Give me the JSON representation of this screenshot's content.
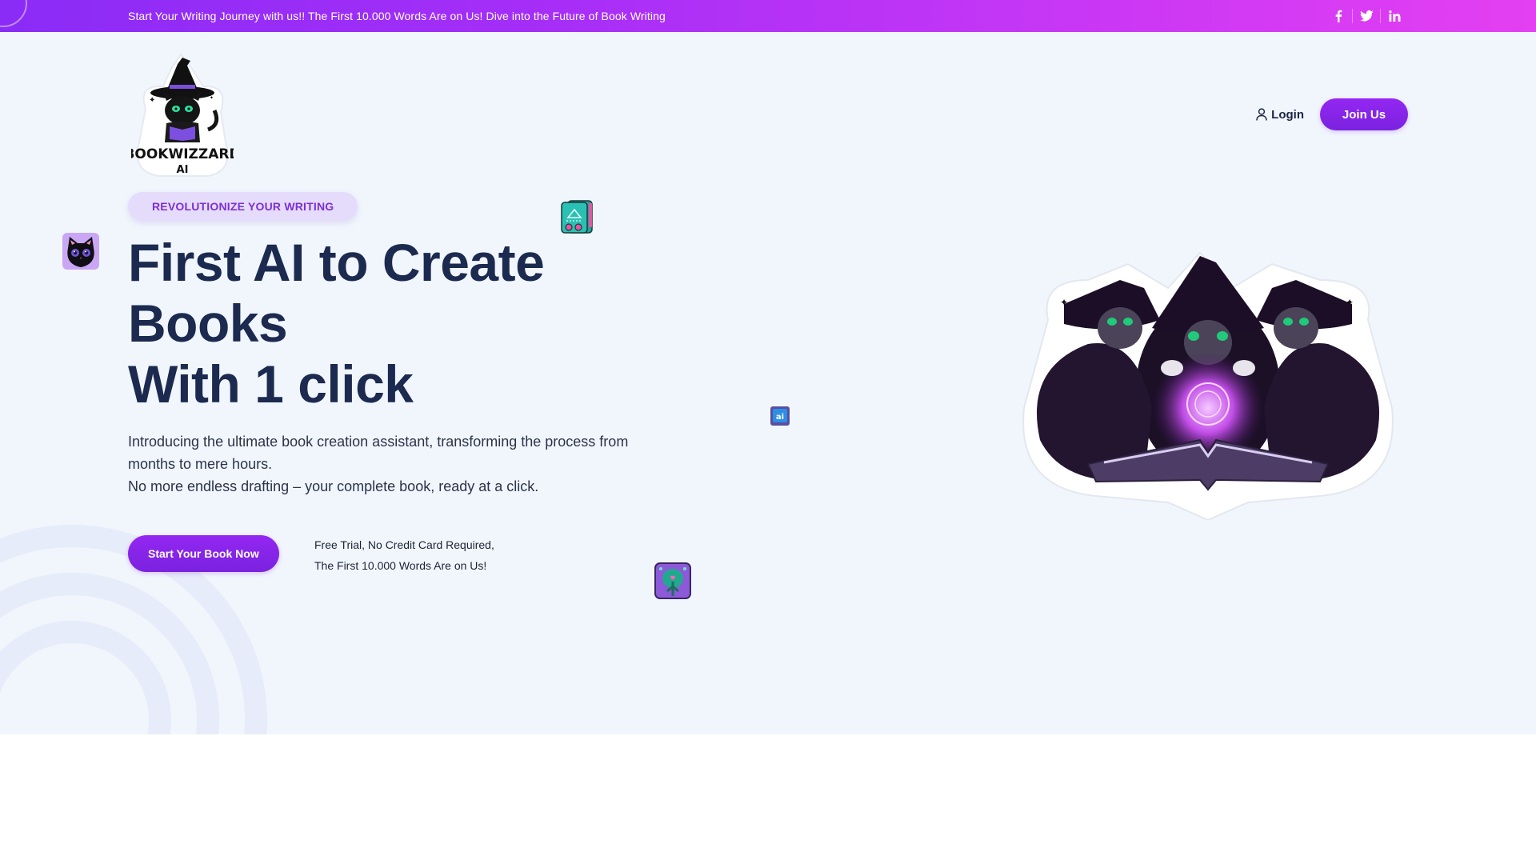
{
  "topbar": {
    "announcement": "Start Your Writing Journey with us!! The First 10.000 Words Are on Us! Dive into the Future of Book Writing",
    "socials": [
      {
        "name": "facebook",
        "icon": "facebook-icon",
        "glyph": "f"
      },
      {
        "name": "twitter",
        "icon": "twitter-icon",
        "glyph": "🐦"
      },
      {
        "name": "linkedin",
        "icon": "linkedin-icon",
        "glyph": "in"
      }
    ],
    "gradient": [
      "#8a2cf6",
      "#e43ff2"
    ]
  },
  "header": {
    "logo": {
      "name": "BookWizzard AI",
      "line1": "BOOKWIZZARD",
      "line2": "AI"
    },
    "login_label": "Login",
    "login_icon": "user-icon",
    "join_label": "Join Us"
  },
  "hero": {
    "badge": "REVOLUTIONIZE YOUR WRITING",
    "headline": [
      "First AI to Create",
      "Books",
      "With 1 click"
    ],
    "description": [
      "Introducing the ultimate book creation assistant, transforming the process from",
      "months to mere hours.",
      "No more endless drafting – your complete book, ready at a click."
    ],
    "cta_label": "Start Your Book Now",
    "cta_note": [
      "Free Trial, No Credit Card Required,",
      "The First 10.000 Words Are on Us!"
    ],
    "illustration": "three wizard cats reading a glowing spellbook",
    "stickers": [
      "black-cat-sticker",
      "ai-book-sticker",
      "ai-chip-sticker",
      "circuit-tree-sticker"
    ]
  },
  "colors": {
    "accent": "#8a2cf6",
    "heading": "#1b2a4e",
    "hero_bg": "#f1f6fd",
    "badge_bg": "#e5dcfb",
    "badge_text": "#7d2fd6"
  }
}
